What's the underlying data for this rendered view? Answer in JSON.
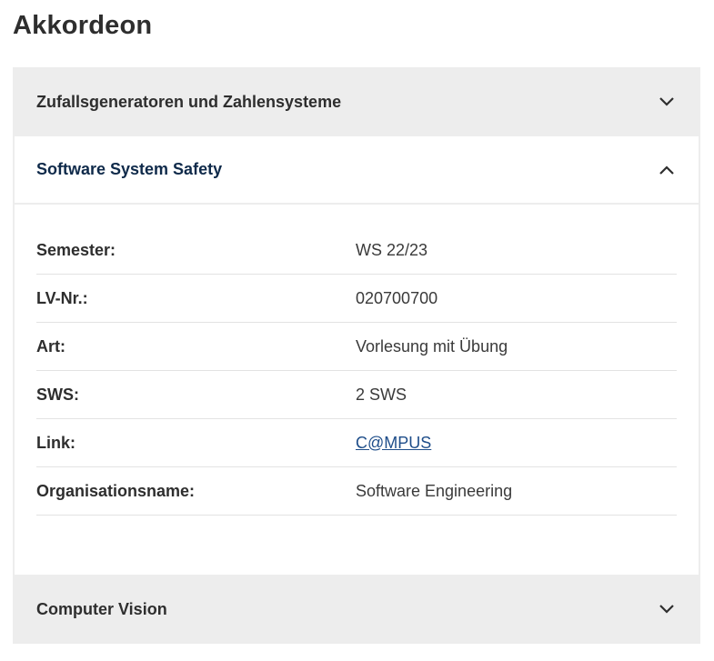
{
  "page": {
    "title": "Akkordeon"
  },
  "accordion": {
    "items": [
      {
        "title": "Zufallsgeneratoren und Zahlensysteme",
        "state": "collapsed"
      },
      {
        "title": "Software System Safety",
        "state": "expanded",
        "details": [
          {
            "label": "Semester:",
            "value": "WS 22/23"
          },
          {
            "label": "LV-Nr.:",
            "value": "020700700"
          },
          {
            "label": "Art:",
            "value": "Vorlesung mit Übung"
          },
          {
            "label": "SWS:",
            "value": "2 SWS"
          },
          {
            "label": "Link:",
            "value": "C@MPUS",
            "is_link": true
          },
          {
            "label": "Organisationsname:",
            "value": "Software Engineering"
          }
        ]
      },
      {
        "title": "Computer Vision",
        "state": "collapsed"
      }
    ]
  },
  "icons": {
    "collapsed": "chevron-down-icon",
    "expanded": "chevron-up-icon"
  },
  "colors": {
    "header_bg": "#ededed",
    "active_title": "#0f2a4a",
    "link": "#1f4e8a"
  }
}
